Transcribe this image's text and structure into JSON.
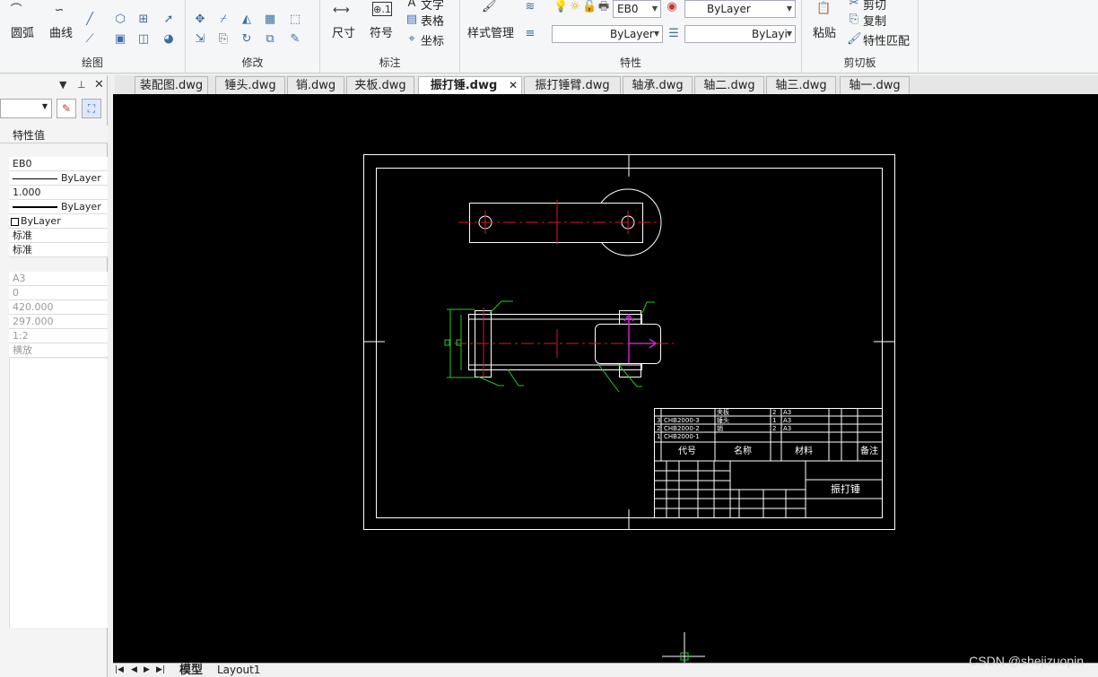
{
  "ribbon": {
    "draw": {
      "arc": "圆弧",
      "curve": "曲线",
      "group": "绘图"
    },
    "modify": {
      "group": "修改"
    },
    "annot": {
      "dimension": "尺寸",
      "symbol": "符号",
      "text": "文字",
      "table": "表格",
      "coord": "坐标",
      "group": "标注"
    },
    "style": {
      "manager": "样式管理"
    },
    "props": {
      "layer": "EB0",
      "color": "ByLayer",
      "linetype1": "ByLayer",
      "linetype2": "ByLayi",
      "group": "特性"
    },
    "clipboard": {
      "paste": "粘贴",
      "cut": "剪切",
      "copy": "复制",
      "match": "特性匹配",
      "group": "剪切板"
    }
  },
  "tabs": [
    "装配图.dwg",
    "锤头.dwg",
    "销.dwg",
    "夹板.dwg",
    "振打锤.dwg",
    "振打锤臂.dwg",
    "轴承.dwg",
    "轴二.dwg",
    "轴三.dwg",
    "轴一.dwg"
  ],
  "active_tab": "振打锤.dwg",
  "panel": {
    "header": "特性值",
    "rows": [
      "EB0",
      "ByLayer",
      "1.000",
      "ByLayer",
      "ByLayer",
      "标准",
      "标准"
    ],
    "rows_dim": [
      "A3",
      "0",
      "420.000",
      "297.000",
      "1:2",
      "横放"
    ]
  },
  "drawing": {
    "title": "振打锤",
    "table_codes": [
      "CHB2000-3",
      "CHB2000-2",
      "CHB2000-1"
    ],
    "table_names": [
      "夹板",
      "锤头",
      "销"
    ],
    "table_qty": [
      "2",
      "1",
      "2"
    ],
    "table_mat": [
      "A3",
      "A3",
      "A3"
    ],
    "header_code": "代号",
    "header_name": "名称",
    "header_mat": "材料",
    "header_remark": "备注"
  },
  "layouts": {
    "model": "模型",
    "layout1": "Layout1"
  },
  "watermark": "CSDN @shejizuopin",
  "colors": {
    "canvas": "#000000",
    "red": "#e0142a",
    "green": "#22cc22",
    "magenta": "#cc22cc"
  }
}
